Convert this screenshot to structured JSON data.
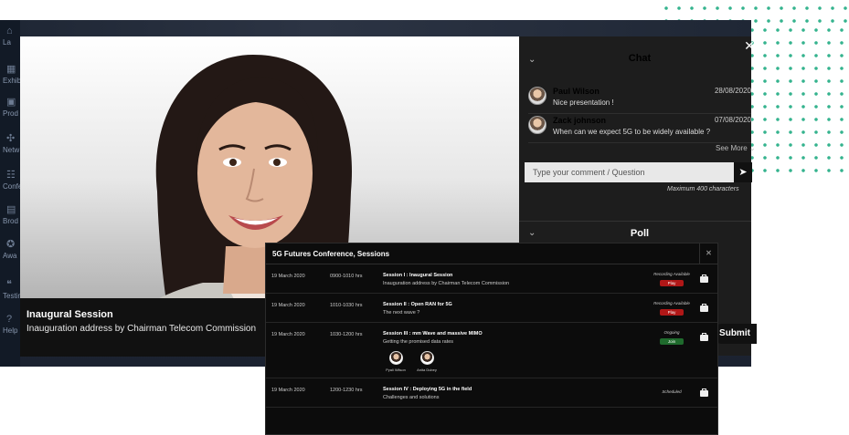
{
  "nav": {
    "items": [
      {
        "label": "La",
        "icon": "lobby-icon"
      },
      {
        "label": "Exhib",
        "icon": "exhibition-icon"
      },
      {
        "label": "Prod",
        "icon": "products-icon"
      },
      {
        "label": "Netw",
        "icon": "network-icon"
      },
      {
        "label": "Confe",
        "icon": "conference-icon"
      },
      {
        "label": "Brod",
        "icon": "broadcast-icon"
      },
      {
        "label": "Awa",
        "icon": "awards-icon"
      },
      {
        "label": "Testim",
        "icon": "testimonials-icon"
      },
      {
        "label": "Help",
        "icon": "help-icon"
      }
    ]
  },
  "video": {
    "title": "Inaugural Session",
    "subtitle": "Inauguration address by Chairman Telecom Commission"
  },
  "chat": {
    "title": "Chat",
    "messages": [
      {
        "name": "Paul Wilson",
        "date": "28/08/2020",
        "text": "Nice presentation !"
      },
      {
        "name": "Zack johnson",
        "date": "07/08/2020",
        "text": "When can we expect 5G to be widely available ?"
      }
    ],
    "see_more": "See More",
    "input_placeholder": "Type your comment / Question",
    "char_limit": "Maximum 400 characters"
  },
  "poll": {
    "title": "Poll",
    "submit_label": "Submit"
  },
  "sessions": {
    "title": "5G Futures Conference, Sessions",
    "rows": [
      {
        "date": "19 March 2020",
        "time": "0900-1010 hrs",
        "title": "Session I : Inaugural Session",
        "desc": "Inauguration address by Chairman Telecom Commission",
        "status": "Recording Available",
        "button": "Play"
      },
      {
        "date": "19 March 2020",
        "time": "1010-1030 hrs",
        "title": "Session II : Open RAN for 5G",
        "desc": "The next wave ?",
        "status": "Recording Available",
        "button": "Play"
      },
      {
        "date": "19 March 2020",
        "time": "1030-1200 hrs",
        "title": "Session III : mm Wave and massive MIMO",
        "desc": "Getting the promised data rates",
        "status": "Ongoing",
        "button": "Join",
        "speakers": [
          {
            "name": "Pyali Wilson"
          },
          {
            "name": "Anita Dubey"
          }
        ]
      },
      {
        "date": "19 March 2020",
        "time": "1200-1230 hrs",
        "title": "Session IV : Deploying 5G in the field",
        "desc": "Challenges and solutions",
        "status": "Scheduled",
        "button": ""
      }
    ]
  },
  "colors": {
    "accent_dots": "#35b38e",
    "play": "#b01717",
    "join": "#1f6b2d"
  }
}
